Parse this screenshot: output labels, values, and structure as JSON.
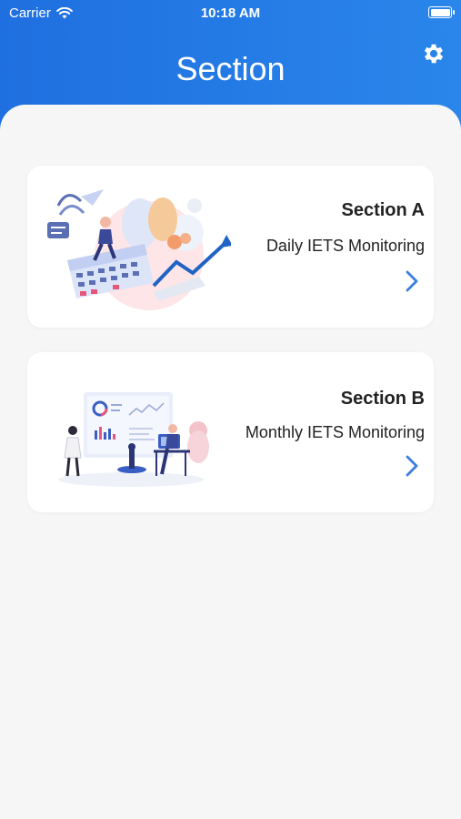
{
  "status_bar": {
    "carrier": "Carrier",
    "time": "10:18 AM"
  },
  "header": {
    "title": "Section",
    "settings_icon": "gear-icon"
  },
  "sections": [
    {
      "name": "Section A",
      "description": "Daily IETS Monitoring",
      "icon": "chevron-right-icon"
    },
    {
      "name": "Section B",
      "description": "Monthly IETS Monitoring",
      "icon": "chevron-right-icon"
    }
  ],
  "colors": {
    "header_start": "#1f6fe0",
    "header_end": "#2a86ea",
    "chevron": "#3a7fe0",
    "background": "#f6f6f6"
  }
}
